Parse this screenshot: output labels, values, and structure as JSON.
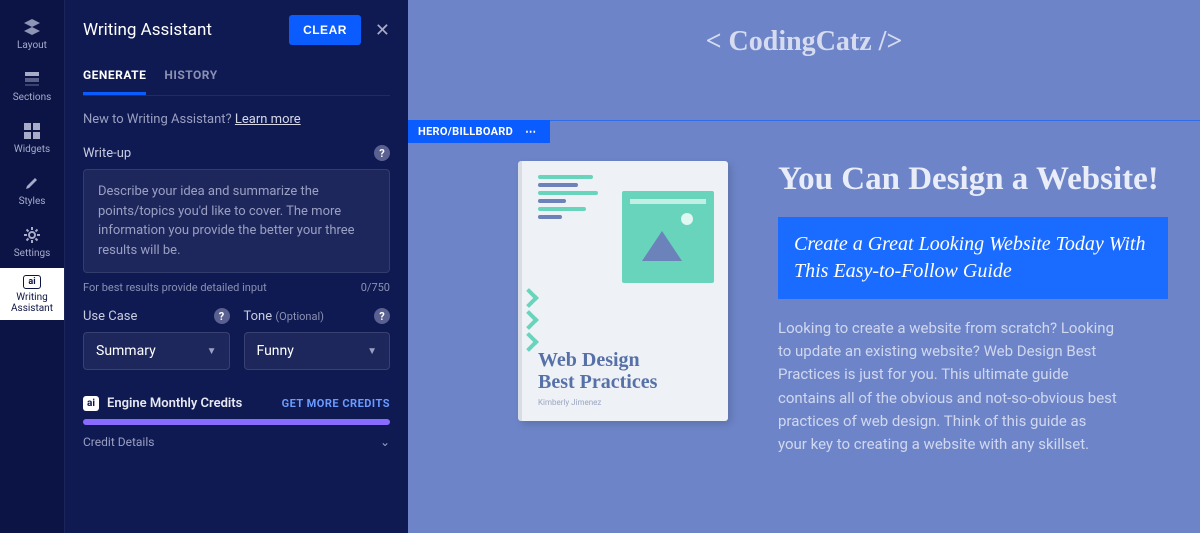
{
  "nav": {
    "items": [
      {
        "label": "Layout",
        "icon": "layout-icon"
      },
      {
        "label": "Sections",
        "icon": "sections-icon"
      },
      {
        "label": "Widgets",
        "icon": "widgets-icon"
      },
      {
        "label": "Styles",
        "icon": "styles-icon"
      },
      {
        "label": "Settings",
        "icon": "settings-icon"
      },
      {
        "label": "Writing Assistant",
        "icon": "ai-icon",
        "active": true
      }
    ]
  },
  "panel": {
    "title": "Writing Assistant",
    "clear_label": "CLEAR",
    "tabs": {
      "generate": "GENERATE",
      "history": "HISTORY"
    },
    "hint_prefix": "New to Writing Assistant? ",
    "hint_link": "Learn more",
    "writeup_label": "Write-up",
    "writeup_placeholder": "Describe your idea and summarize the points/topics you'd like to cover. The more information you provide the better your three results will be.",
    "counter_hint": "For best results provide detailed input",
    "counter_value": "0/750",
    "usecase_label": "Use Case",
    "usecase_value": "Summary",
    "tone_label": "Tone",
    "tone_optional": "(Optional)",
    "tone_value": "Funny",
    "credits_badge": "ai",
    "credits_label": "Engine Monthly Credits",
    "get_more": "GET MORE CREDITS",
    "credit_details": "Credit Details"
  },
  "canvas": {
    "brand_left": "< Coding",
    "brand_right": "Catz />",
    "section_tag": "HERO/BILLBOARD",
    "book_title_line1": "Web Design",
    "book_title_line2": "Best Practices",
    "book_author": "Kimberly Jimenez",
    "hero_heading": "You Can Design a Website!",
    "hero_sub": "Create a Great Looking Website Today With This Easy-to-Follow Guide",
    "hero_body": "Looking to create a website from scratch? Looking to update an existing website? Web Design Best Practices is just for you. This ultimate guide contains all of the obvious and not-so-obvious best practices of web design. Think of this guide as your key to creating a website with any skillset."
  }
}
